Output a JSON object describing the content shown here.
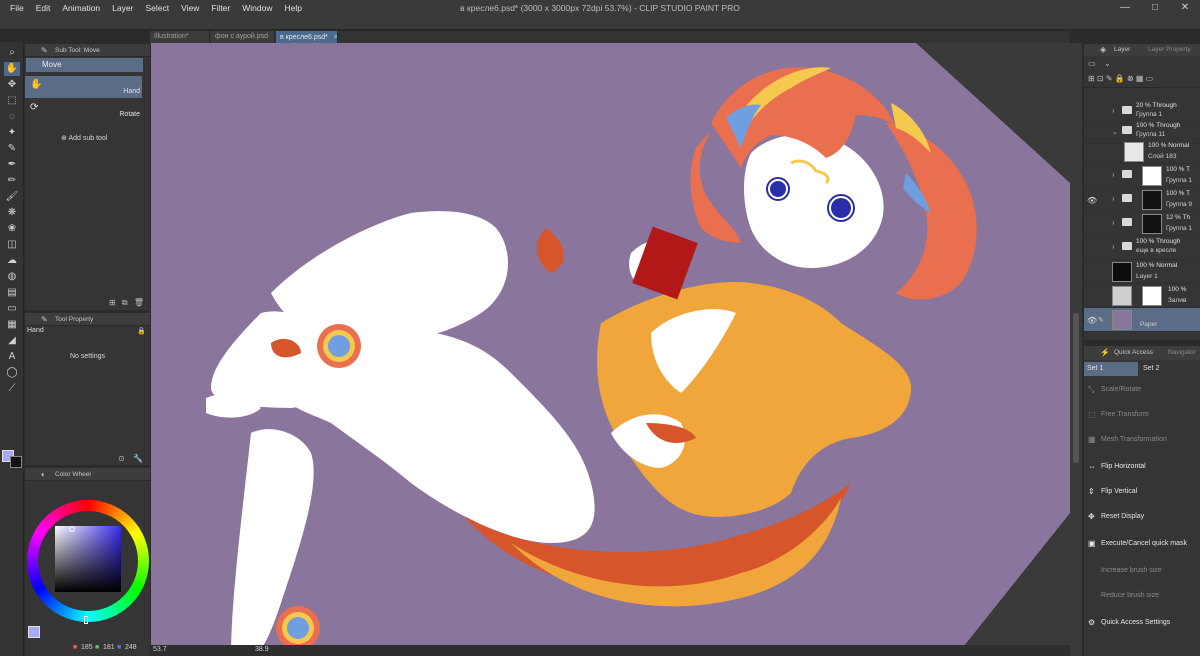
{
  "window": {
    "title": "в кресле6.psd* (3000 x 3000px 72dpi 53.7%) - CLIP STUDIO PAINT PRO",
    "controls": [
      "—",
      "□",
      "✕"
    ]
  },
  "menu": [
    "File",
    "Edit",
    "Animation",
    "Layer",
    "Select",
    "View",
    "Filter",
    "Window",
    "Help"
  ],
  "tabs": [
    {
      "label": "Illustration*",
      "close": "✕"
    },
    {
      "label": "фон с аурой.psd",
      "close": "✕"
    },
    {
      "label": "в кресле6.psd*",
      "close": "✕"
    }
  ],
  "subtool": {
    "panel_title": "Sub Tool: Move",
    "group": "Move",
    "items": [
      "Hand",
      "Rotate"
    ],
    "add_label": "Add sub tool",
    "footer_icons": "⊞ ⧉ 🗑"
  },
  "tool_property": {
    "panel_title": "Tool Property",
    "tool_name": "Hand",
    "empty_text": "No settings"
  },
  "color_wheel": {
    "panel_title": "Color Wheel",
    "r": "185",
    "g": "181",
    "b": "248",
    "main_color": "#a9a8f5"
  },
  "status": {
    "zoom": "53.7",
    "angle": "38.9"
  },
  "layers": {
    "panel_title": "Layer",
    "panel_tab2": "Layer Property",
    "items": [
      {
        "line1": "20 % Through",
        "line2": "Группа 1"
      },
      {
        "line1": "100 % Through",
        "line2": "Группа 11"
      },
      {
        "line1": "100 % Normal",
        "line2": "Слой 183"
      },
      {
        "line1": "100 % T",
        "line2": "Группа 1"
      },
      {
        "line1": "100 % T",
        "line2": "Группа 9"
      },
      {
        "line1": "12 % Th",
        "line2": "Группа 1"
      },
      {
        "line1": "100 % Through",
        "line2": "еще в кресле"
      },
      {
        "line1": "100 % Normal",
        "line2": "Layer 1"
      },
      {
        "line1": "100 %",
        "line2": "Залив"
      },
      {
        "line1": "",
        "line2": "Paper"
      }
    ]
  },
  "quick_access": {
    "panel_title": "Quick Access",
    "panel_tab2": "Navigator",
    "sets": [
      "Set 1",
      "Set 2"
    ],
    "items": [
      {
        "label": "Scale/Rotate"
      },
      {
        "label": "Free Transform"
      },
      {
        "label": "Mesh Transformation"
      },
      {
        "label": "Flip Horizontal"
      },
      {
        "label": "Flip Vertical"
      },
      {
        "label": "Reset Display"
      },
      {
        "label": "Execute/Cancel quick mask"
      },
      {
        "label": "Increase brush size"
      },
      {
        "label": "Reduce brush size"
      },
      {
        "label": "Quick Access Settings"
      }
    ]
  },
  "canvas": {
    "background": "#8a759d",
    "skin": "#ffffff",
    "hair": "#e96f4e",
    "accent_orange": "#f0a63a",
    "dark_orange": "#d6552a",
    "hair_blue": "#6f9fe0",
    "hair_yellow": "#f5c84e",
    "eye_blue": "#2a2fa8",
    "card_red": "#b21818"
  }
}
